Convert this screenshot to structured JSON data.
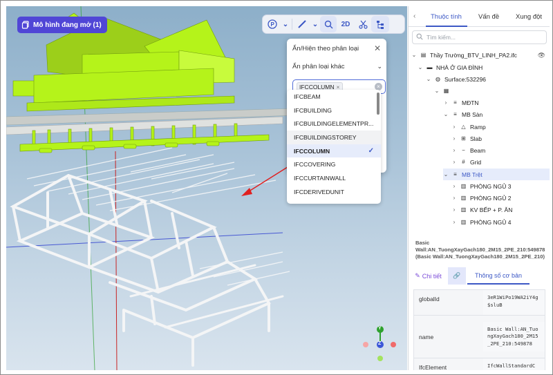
{
  "viewport": {
    "model_button_label": "Mô hình đang mở (1)",
    "toolbar": {
      "btn_2d_label": "2D"
    },
    "filter_panel": {
      "title": "Ẩn/Hiện theo phân loại",
      "dropdown_label": "Ẩn phân loại khác",
      "selected_tag": "IFCCOLUMN",
      "options": [
        "IFCBEAM",
        "IFCBUILDING",
        "IFCBUILDINGELEMENTPR...",
        "IFCBUILDINGSTOREY",
        "IFCCOLUMN",
        "IFCCOVERING",
        "IFCCURTAINWALL",
        "IFCDERIVEDUNIT"
      ],
      "hovered_option": "IFCBUILDINGSTOREY",
      "selected_option": "IFCCOLUMN"
    },
    "axis_labels": {
      "y": "Y",
      "z": "Z"
    }
  },
  "right_panel": {
    "tabs": [
      "Thuộc tính",
      "Vấn đề",
      "Xung đột"
    ],
    "active_tab": "Thuộc tính",
    "search_placeholder": "Tìm kiếm...",
    "tree": [
      {
        "label": "Thầy Trường_BTV_LINH_PA2.ifc"
      },
      {
        "label": "NHÀ Ở GIA ĐÌNH"
      },
      {
        "label": "Surface:532296"
      },
      {
        "label": ""
      },
      {
        "label": "MĐTN"
      },
      {
        "label": "MB Sàn"
      },
      {
        "label": "Ramp"
      },
      {
        "label": "Slab"
      },
      {
        "label": "Beam"
      },
      {
        "label": "Grid"
      },
      {
        "label": "MB Trệt"
      },
      {
        "label": "PHÒNG NGỦ 3"
      },
      {
        "label": "PHÒNG NGỦ 2"
      },
      {
        "label": "KV BẾP + P. ĂN"
      },
      {
        "label": "PHÒNG NGỦ 4"
      }
    ],
    "selected_title": "Basic Wall:AN_TuongXayGach180_2M15_2PE_210:549878",
    "selected_subtitle": "(Basic Wall:AN_TuongXayGach180_2M15_2PE_210)",
    "detail_tabs": {
      "detail": "Chi tiết",
      "basic": "Thông số cơ bản"
    },
    "properties": [
      {
        "key": "globalId",
        "value": "3eR1WiPo19WA2iY4g$sluB"
      },
      {
        "key": "name",
        "value": "Basic Wall:AN_TuongXayGach180_2M15_2PE_210:549878"
      },
      {
        "key": "IfcElement",
        "value": "IfcWallStandardC"
      }
    ]
  },
  "colors": {
    "accent": "#3b57c5",
    "model_button": "#5046d6",
    "house": "#b5f31a"
  }
}
